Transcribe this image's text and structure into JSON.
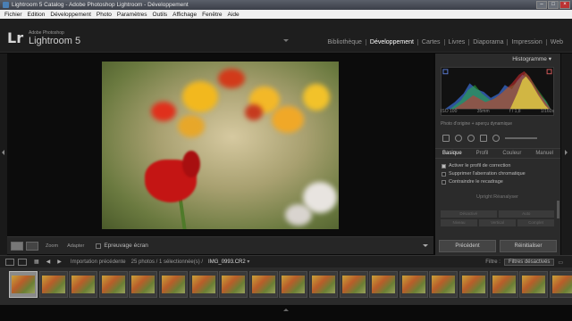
{
  "window": {
    "title": "Lightroom 5 Catalog - Adobe Photoshop Lightroom - Développement"
  },
  "menu": [
    "Fichier",
    "Edition",
    "Développement",
    "Photo",
    "Paramètres",
    "Outils",
    "Affichage",
    "Fenêtre",
    "Aide"
  ],
  "identity": {
    "logo": "Lr",
    "brand": "Adobe Photoshop",
    "product": "Lightroom 5"
  },
  "modules": [
    {
      "label": "Bibliothèque",
      "active": false
    },
    {
      "label": "Développement",
      "active": true
    },
    {
      "label": "Cartes",
      "active": false
    },
    {
      "label": "Livres",
      "active": false
    },
    {
      "label": "Diaporama",
      "active": false
    },
    {
      "label": "Impression",
      "active": false
    },
    {
      "label": "Web",
      "active": false
    }
  ],
  "toolbar": {
    "zoom_label": "Zoom",
    "fit_label": "Adapter",
    "softproof_label": "Epreuvage écran"
  },
  "right_panel": {
    "histogram_title": "Histogramme",
    "exif": [
      "ISO 100",
      "35mm",
      "f / 1,8",
      "1/160s"
    ],
    "original_label": "Photo d'origine + aperçu dynamique",
    "tabs": [
      {
        "label": "Basique",
        "active": true
      },
      {
        "label": "Profil",
        "active": false
      },
      {
        "label": "Couleur",
        "active": false
      },
      {
        "label": "Manuel",
        "active": false
      }
    ],
    "options": [
      {
        "label": "Activer le profil de correction",
        "checked": true
      },
      {
        "label": "Supprimer l'aberration chromatique",
        "checked": false
      },
      {
        "label": "Contraindre le recadrage",
        "checked": false
      }
    ],
    "upright_label": "Upright",
    "reanalyze_label": "Réanalyser",
    "upright_buttons": [
      "Désactivé",
      "Auto"
    ],
    "upright_buttons2": [
      "Niveau",
      "Vertical",
      "Complet"
    ],
    "prev_button": "Précédent",
    "reset_button": "Réinitialiser"
  },
  "filmbar": {
    "source": "Importation précédente",
    "count": "25 photos / 1 sélectionnée(s) /",
    "filename": "IMG_0993.CR2",
    "filter_label": "Filtre :",
    "filter_value": "Filtres désactivés"
  },
  "filmstrip": {
    "thumbnail_count": 19
  }
}
